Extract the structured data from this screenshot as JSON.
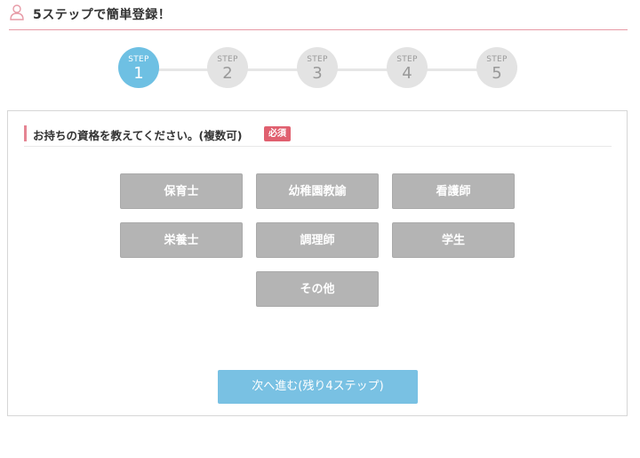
{
  "header": {
    "icon": "user-icon",
    "title": "5ステップで簡単登録！",
    "accent_color": "#e79aa6"
  },
  "stepper": {
    "current": 1,
    "active_color": "#6ec0e3",
    "steps": [
      {
        "word": "STEP",
        "number": "1"
      },
      {
        "word": "STEP",
        "number": "2"
      },
      {
        "word": "STEP",
        "number": "3"
      },
      {
        "word": "STEP",
        "number": "4"
      },
      {
        "word": "STEP",
        "number": "5"
      }
    ]
  },
  "question": {
    "text": "お持ちの資格を教えてください。(複数可)",
    "required_label": "必須",
    "required_color": "#e0606f"
  },
  "options": [
    {
      "label": "保育士"
    },
    {
      "label": "幼稚園教諭"
    },
    {
      "label": "看護師"
    },
    {
      "label": "栄養士"
    },
    {
      "label": "調理師"
    },
    {
      "label": "学生"
    },
    {
      "label": "その他"
    }
  ],
  "next_button": {
    "label": "次へ進む(残り4ステップ)",
    "color": "#79c1e3"
  }
}
